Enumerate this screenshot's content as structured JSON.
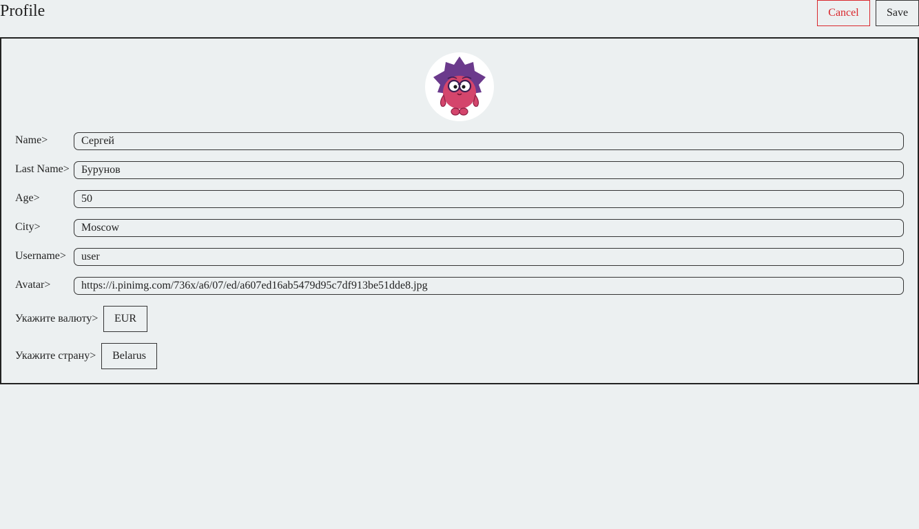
{
  "header": {
    "title": "Profile",
    "cancel_label": "Cancel",
    "save_label": "Save"
  },
  "avatar": {
    "icon": "hedgehog-character-icon"
  },
  "form": {
    "fields": [
      {
        "label": "Name>",
        "value": "Сергей"
      },
      {
        "label": "Last Name>",
        "value": "Бурунов"
      },
      {
        "label": "Age>",
        "value": "50"
      },
      {
        "label": "City>",
        "value": "Moscow"
      },
      {
        "label": "Username>",
        "value": "user"
      },
      {
        "label": "Avatar>",
        "value": "https://i.pinimg.com/736x/a6/07/ed/a607ed16ab5479d95c7df913be51dde8.jpg"
      }
    ],
    "currency": {
      "label": "Укажите валюту>",
      "value": "EUR"
    },
    "country": {
      "label": "Укажите страну>",
      "value": "Belarus"
    }
  },
  "colors": {
    "background": "#ecf0f1",
    "cancel_accent": "#d9262c",
    "border": "#333333"
  }
}
